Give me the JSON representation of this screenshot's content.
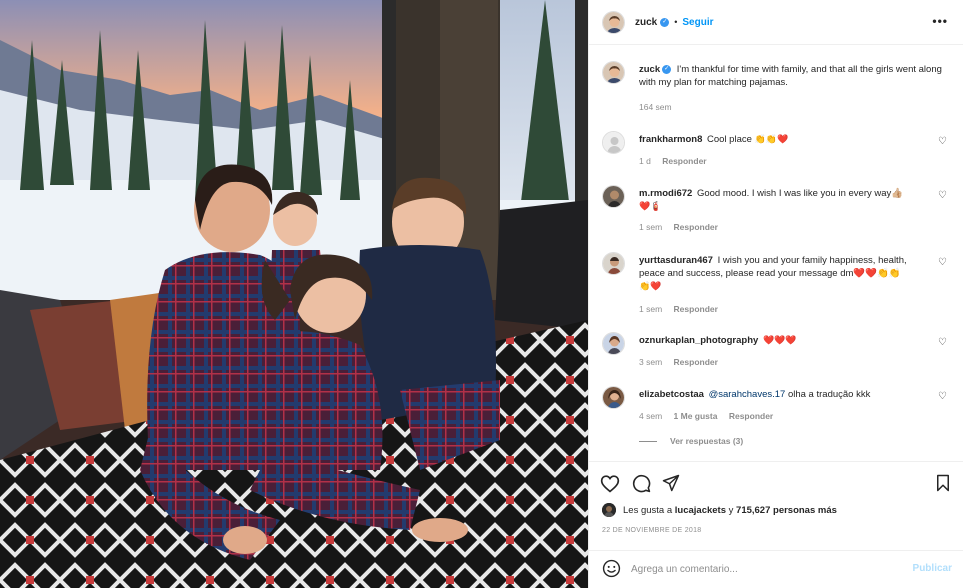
{
  "post": {
    "username": "zuck",
    "verified_mark": "✓",
    "separator": "•",
    "follow_label": "Seguir",
    "more_label": "•••"
  },
  "caption": {
    "username": "zuck",
    "text": "I'm thankful for time with family, and that all the girls went along with my plan for matching pajamas.",
    "time": "164 sem"
  },
  "comments": [
    {
      "username": "frankharmon8",
      "text": "Cool place",
      "emoji": "👏👏❤️",
      "time": "1 d",
      "likes": "",
      "reply": "Responder"
    },
    {
      "username": "m.rmodi672",
      "text": "Good mood. I wish I was like you in every way👍🏼",
      "emoji": "❤️🧯",
      "time": "1 sem",
      "likes": "",
      "reply": "Responder"
    },
    {
      "username": "yurttasduran467",
      "text": "I wish you and your family happiness, health, peace and success, please read your message dm❤️❤️👏👏",
      "emoji": "👏❤️",
      "time": "1 sem",
      "likes": "",
      "reply": "Responder"
    },
    {
      "username": "oznurkaplan_photography",
      "text": "",
      "emoji": "❤️❤️❤️",
      "time": "3 sem",
      "likes": "",
      "reply": "Responder"
    },
    {
      "username": "elizabetcostaa",
      "mention": "@sarahchaves.17",
      "text": "olha a tradução kkk",
      "emoji": "",
      "time": "4 sem",
      "likes": "1 Me gusta",
      "reply": "Responder"
    }
  ],
  "view_replies": "Ver respuestas (3)",
  "likes_line": {
    "prefix": "Les gusta a",
    "user": "lucajackets",
    "middle": "y",
    "count": "715,627 personas más"
  },
  "date": "22 DE NOVIEMBRE DE 2018",
  "add_comment": {
    "placeholder": "Agrega un comentario...",
    "publish_label": "Publicar"
  },
  "icons": {
    "heart": "heart-icon",
    "comment": "comment-icon",
    "share": "share-icon",
    "save": "bookmark-icon",
    "emoji": "emoji-icon",
    "more": "more-icon"
  },
  "colors": {
    "link_blue": "#0095f6",
    "verified_blue": "#3897f0",
    "muted": "#8e8e8e",
    "publish_disabled": "#b2dffc"
  }
}
